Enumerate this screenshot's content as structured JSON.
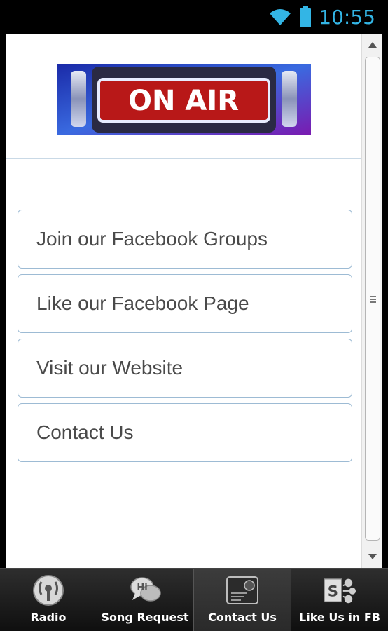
{
  "status_bar": {
    "time": "10:55"
  },
  "banner": {
    "text": "ON AIR"
  },
  "menu": {
    "items": [
      {
        "label": "Join our Facebook Groups"
      },
      {
        "label": "Like our Facebook Page"
      },
      {
        "label": "Visit our Website"
      },
      {
        "label": "Contact Us"
      }
    ]
  },
  "tabs": [
    {
      "label": "Radio",
      "icon": "radio-icon"
    },
    {
      "label": "Song Request",
      "icon": "chat-bubble-icon"
    },
    {
      "label": "Contact Us",
      "icon": "contact-card-icon",
      "active": true
    },
    {
      "label": "Like Us in FB",
      "icon": "sharepoint-icon"
    }
  ],
  "colors": {
    "status_accent": "#33b5e5",
    "button_border": "#9dbbd4",
    "banner_red": "#c81e1e"
  }
}
